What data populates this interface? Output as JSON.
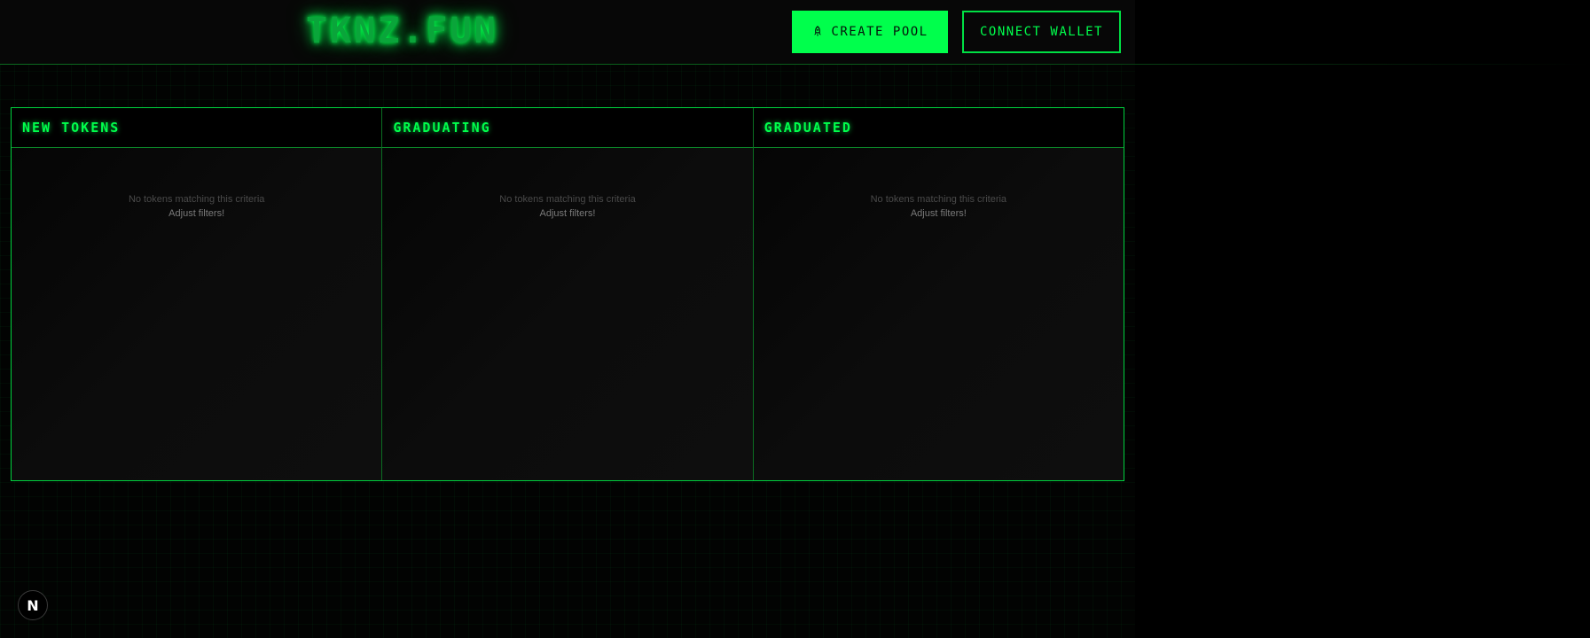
{
  "header": {
    "logo": "TKNZ.FUN",
    "create_pool_label": "CREATE POOL",
    "create_pool_icon": "rocket-icon",
    "connect_wallet_label": "CONNECT WALLET"
  },
  "columns": [
    {
      "title": "NEW TOKENS",
      "empty_message": "No tokens matching this criteria",
      "empty_hint": "Adjust filters!"
    },
    {
      "title": "GRADUATING",
      "empty_message": "No tokens matching this criteria",
      "empty_hint": "Adjust filters!"
    },
    {
      "title": "GRADUATED",
      "empty_message": "No tokens matching this criteria",
      "empty_hint": "Adjust filters!"
    }
  ],
  "dev_badge": {
    "label": "N",
    "icon": "nextjs-icon"
  },
  "colors": {
    "accent": "#00ff4c",
    "background": "#000000",
    "border": "#00d23e"
  }
}
